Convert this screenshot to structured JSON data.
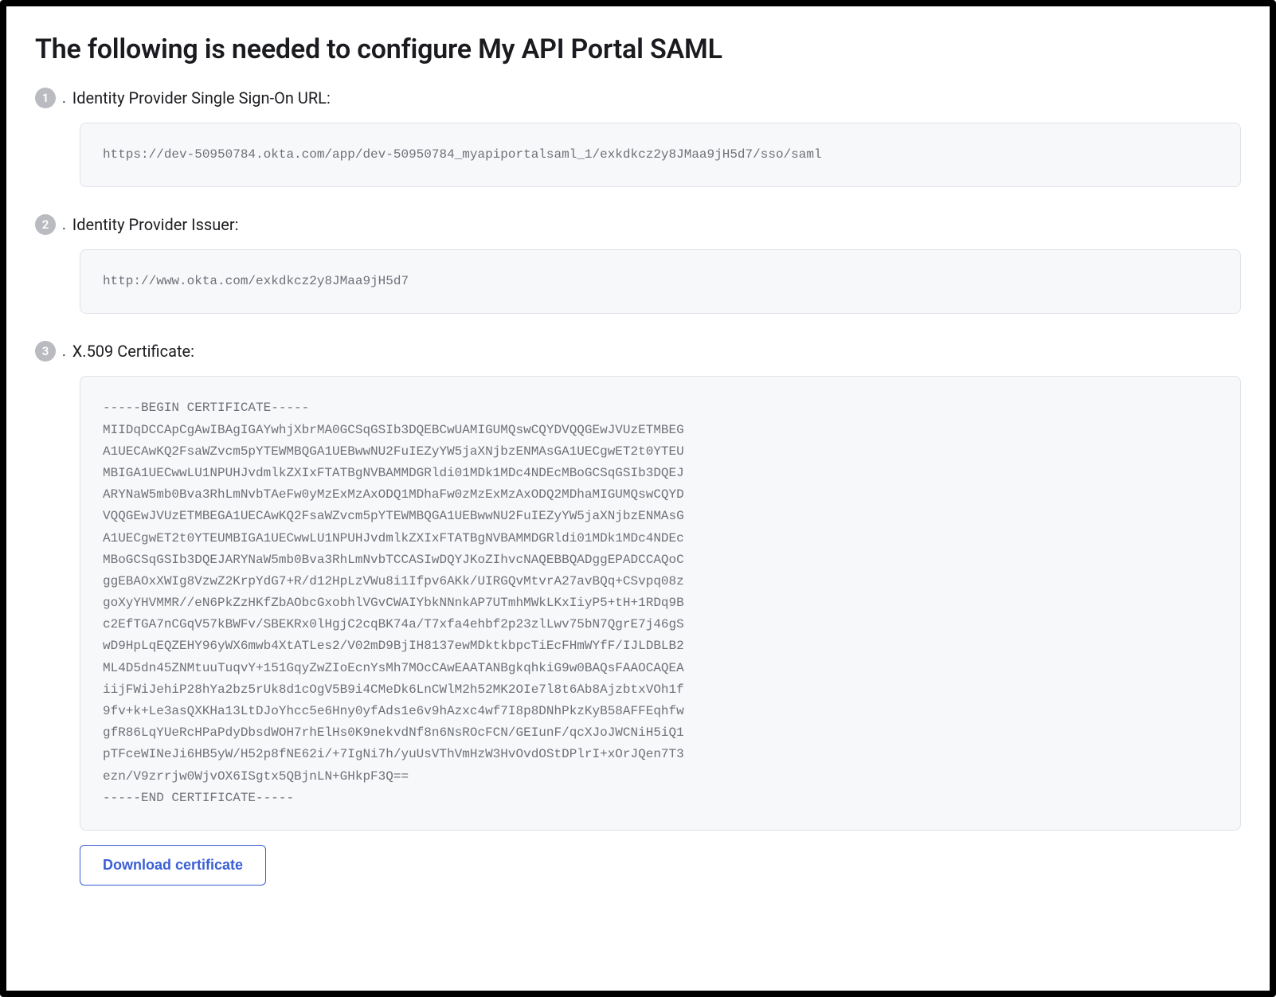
{
  "title": "The following is needed to configure My API Portal SAML",
  "steps": [
    {
      "num": "1",
      "label": "Identity Provider Single Sign-On URL:",
      "value": "https://dev-50950784.okta.com/app/dev-50950784_myapiportalsaml_1/exkdkcz2y8JMaa9jH5d7/sso/saml"
    },
    {
      "num": "2",
      "label": "Identity Provider Issuer:",
      "value": "http://www.okta.com/exkdkcz2y8JMaa9jH5d7"
    },
    {
      "num": "3",
      "label": "X.509 Certificate:",
      "value": "-----BEGIN CERTIFICATE-----\nMIIDqDCCApCgAwIBAgIGAYwhjXbrMA0GCSqGSIb3DQEBCwUAMIGUMQswCQYDVQQGEwJVUzETMBEG\nA1UECAwKQ2FsaWZvcm5pYTEWMBQGA1UEBwwNU2FuIEZyYW5jaXNjbzENMAsGA1UECgwET2t0YTEU\nMBIGA1UECwwLU1NPUHJvdmlkZXIxFTATBgNVBAMMDGRldi01MDk1MDc4NDEcMBoGCSqGSIb3DQEJ\nARYNaW5mb0Bva3RhLmNvbTAeFw0yMzExMzAxODQ1MDhaFw0zMzExMzAxODQ2MDhaMIGUMQswCQYD\nVQQGEwJVUzETMBEGA1UECAwKQ2FsaWZvcm5pYTEWMBQGA1UEBwwNU2FuIEZyYW5jaXNjbzENMAsG\nA1UECgwET2t0YTEUMBIGA1UECwwLU1NPUHJvdmlkZXIxFTATBgNVBAMMDGRldi01MDk1MDc4NDEc\nMBoGCSqGSIb3DQEJARYNaW5mb0Bva3RhLmNvbTCCASIwDQYJKoZIhvcNAQEBBQADggEPADCCAQoC\nggEBAOxXWIg8VzwZ2KrpYdG7+R/d12HpLzVWu8i1Ifpv6AKk/UIRGQvMtvrA27avBQq+CSvpq08z\ngoXyYHVMMR//eN6PkZzHKfZbAObcGxobhlVGvCWAIYbkNNnkAP7UTmhMWkLKxIiyP5+tH+1RDq9B\nc2EfTGA7nCGqV57kBWFv/SBEKRx0lHgjC2cqBK74a/T7xfa4ehbf2p23zlLwv75bN7QgrE7j46gS\nwD9HpLqEQZEHY96yWX6mwb4XtATLes2/V02mD9BjIH8137ewMDktkbpcTiEcFHmWYfF/IJLDBLB2\nML4D5dn45ZNMtuuTuqvY+151GqyZwZIoEcnYsMh7MOcCAwEAATANBgkqhkiG9w0BAQsFAAOCAQEA\niijFWiJehiP28hYa2bz5rUk8d1cOgV5B9i4CMeDk6LnCWlM2h52MK2OIe7l8t6Ab8AjzbtxVOh1f\n9fv+k+Le3asQXKHa13LtDJoYhcc5e6Hny0yfAds1e6v9hAzxc4wf7I8p8DNhPkzKyB58AFFEqhfw\ngfR86LqYUeRcHPaPdyDbsdWOH7rhElHs0K9nekvdNf8n6NsROcFCN/GEIunF/qcXJoJWCNiH5iQ1\npTFceWINeJi6HB5yW/H52p8fNE62i/+7IgNi7h/yuUsVThVmHzW3HvOvdOStDPlrI+xOrJQen7T3\nezn/V9zrrjw0WjvOX6ISgtx5QBjnLN+GHkpF3Q==\n-----END CERTIFICATE-----"
    }
  ],
  "download_label": "Download certificate"
}
